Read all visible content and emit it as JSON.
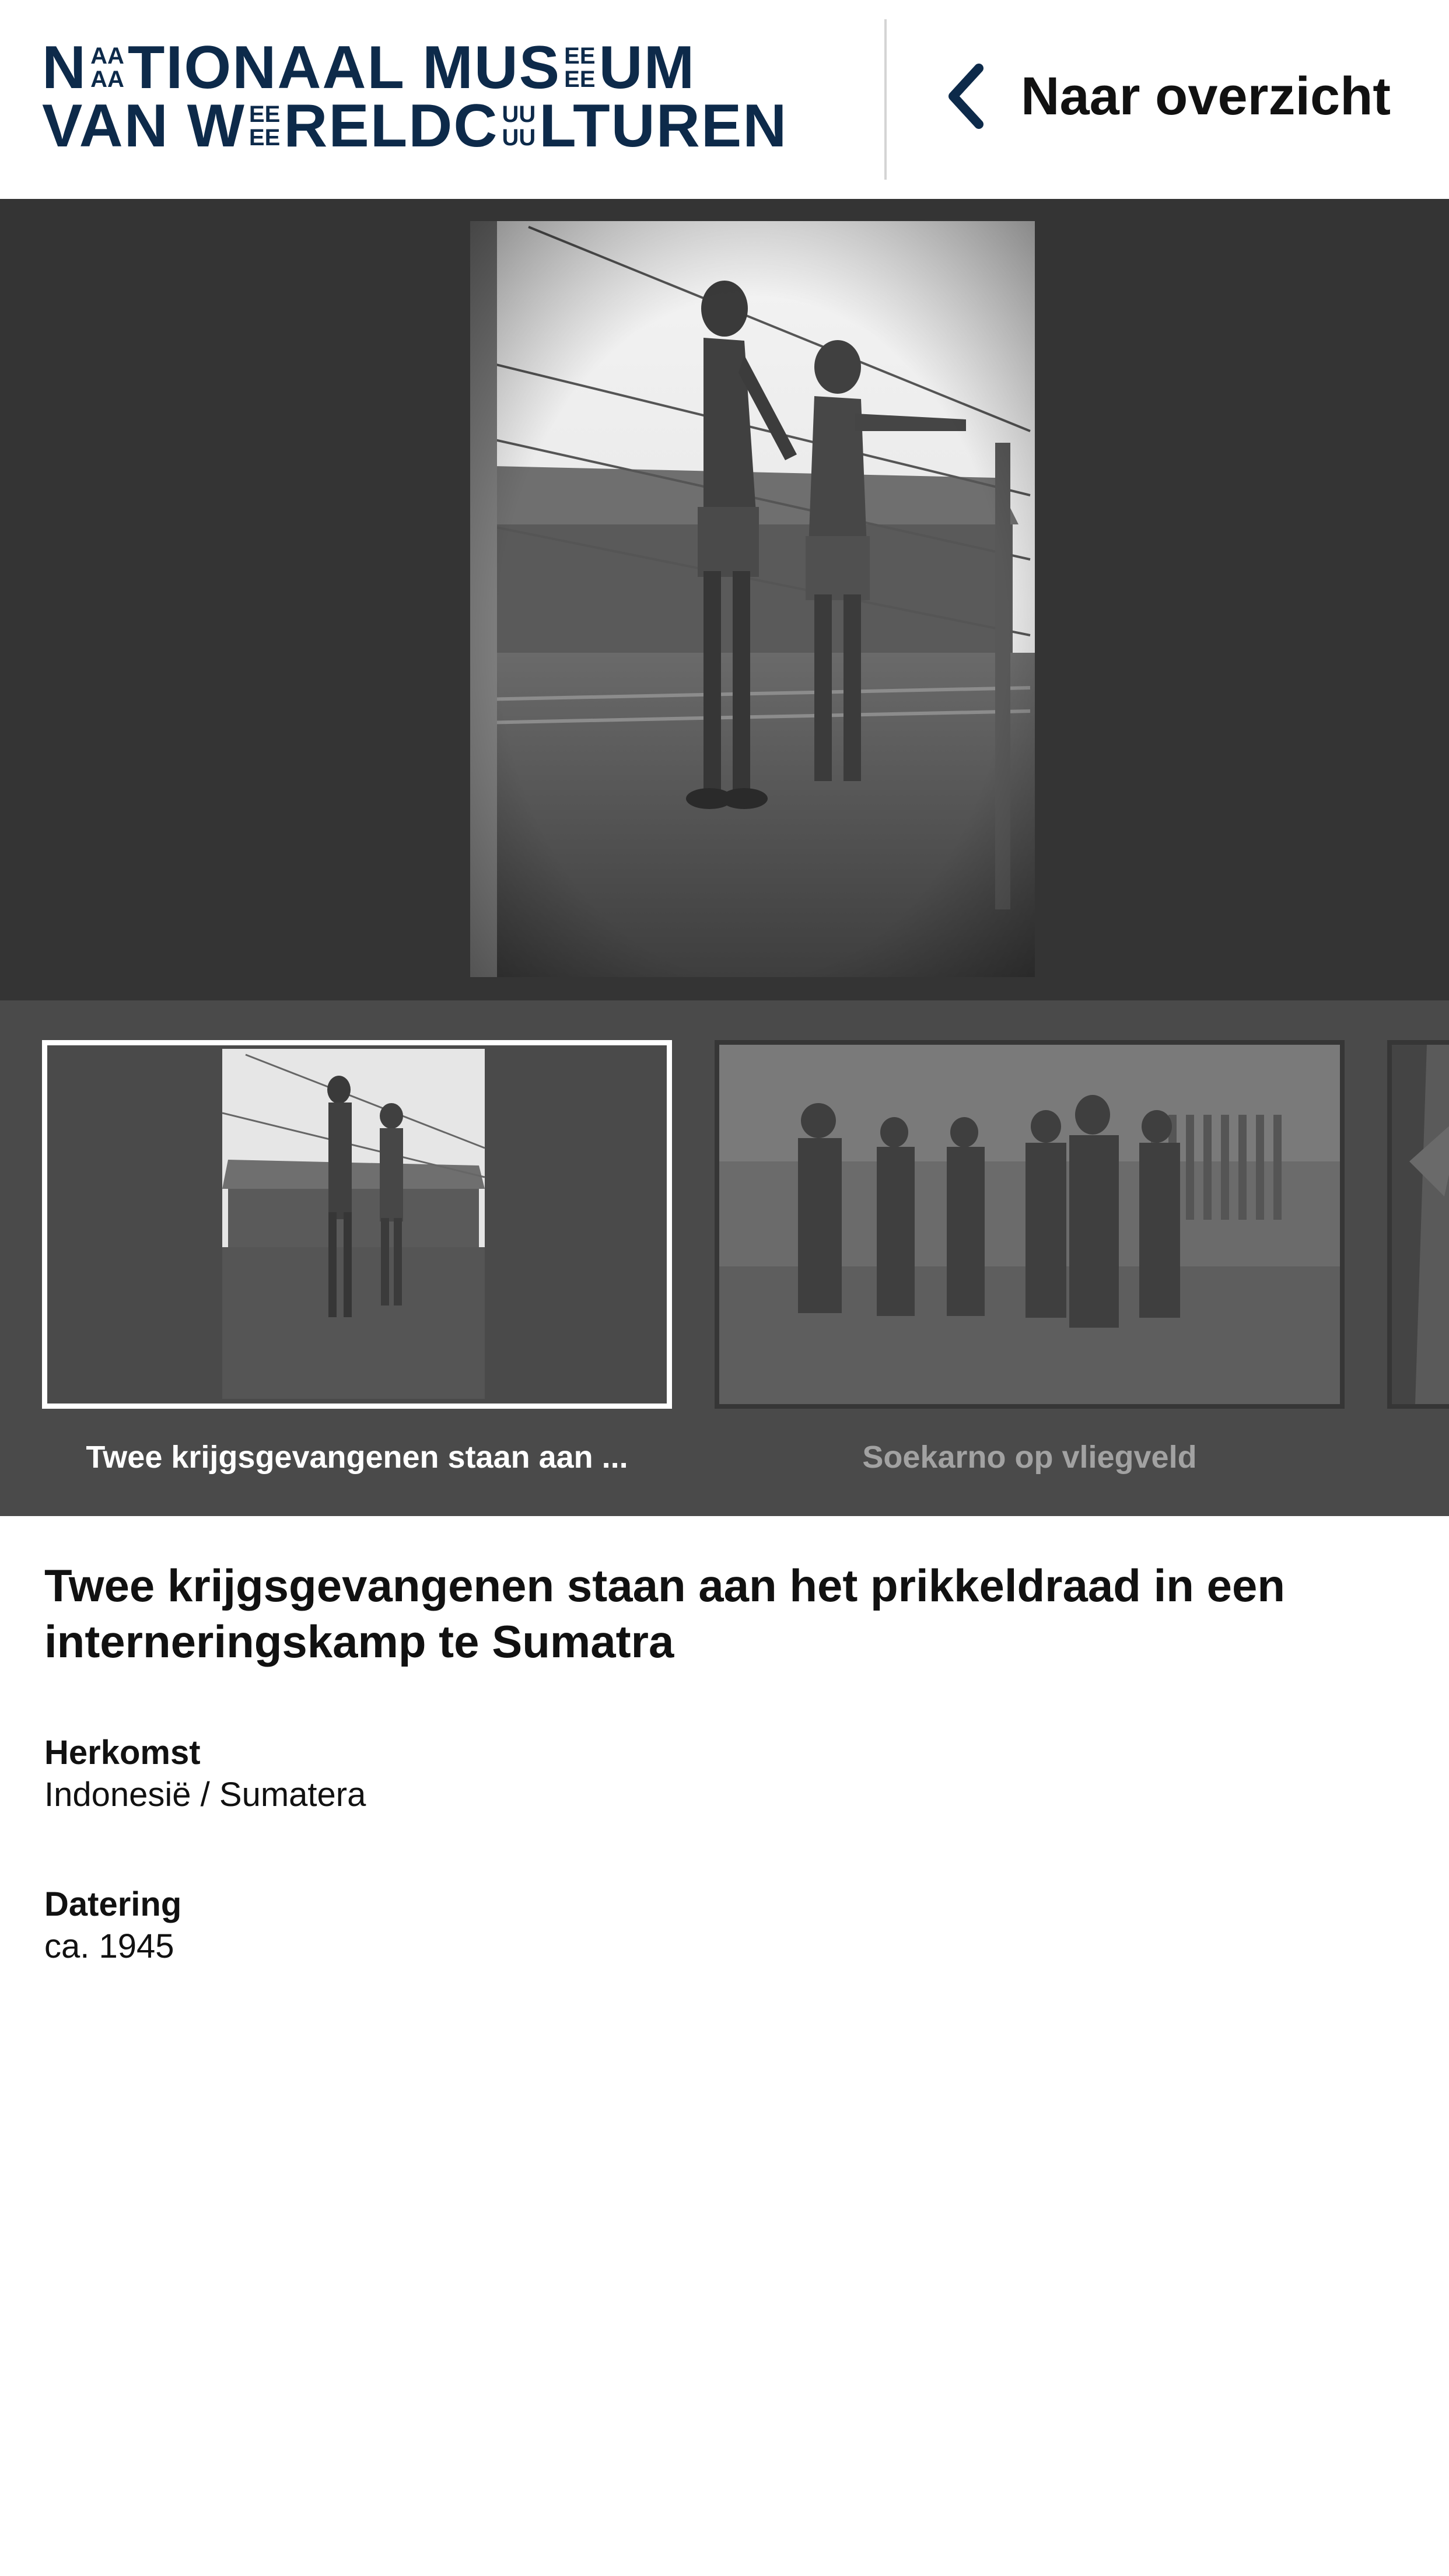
{
  "header": {
    "logo": {
      "line1": {
        "part1": "N",
        "mini_top1": "AA",
        "mini_bot1": "AA",
        "part2": "TIONAAL MUS",
        "mini_top2": "EE",
        "mini_bot2": "EE",
        "part3": "UM"
      },
      "line2": {
        "part1": "VAN W",
        "mini_top1": "EE",
        "mini_bot1": "EE",
        "part2": "RELDC",
        "mini_top2": "UU",
        "mini_bot2": "UU",
        "part3": "LTUREN"
      }
    },
    "back_label": "Naar overzicht"
  },
  "viewer": {
    "image_subject": "two prisoners of war at barbed wire fence"
  },
  "carousel": {
    "items": [
      {
        "caption": "Twee krijgsgevangenen staan aan ...",
        "active": true
      },
      {
        "caption": "Soekarno op vliegveld",
        "active": false
      },
      {
        "caption": "",
        "active": false
      }
    ]
  },
  "object": {
    "title": "Twee krijgsgevangenen staan aan het prikkeldraad in een interneringskamp te Sumatra",
    "fields": [
      {
        "label": "Herkomst",
        "value": "Indonesië / Sumatera"
      },
      {
        "label": "Datering",
        "value": "ca. 1945"
      }
    ]
  },
  "colors": {
    "brand_navy": "#0d2a4a",
    "viewer_bg": "#343434",
    "carousel_bg": "#4a4a4a",
    "active_border": "#ffffff",
    "inactive_caption": "#a2a2a2"
  },
  "icons": {
    "back": "chevron-left-icon"
  }
}
